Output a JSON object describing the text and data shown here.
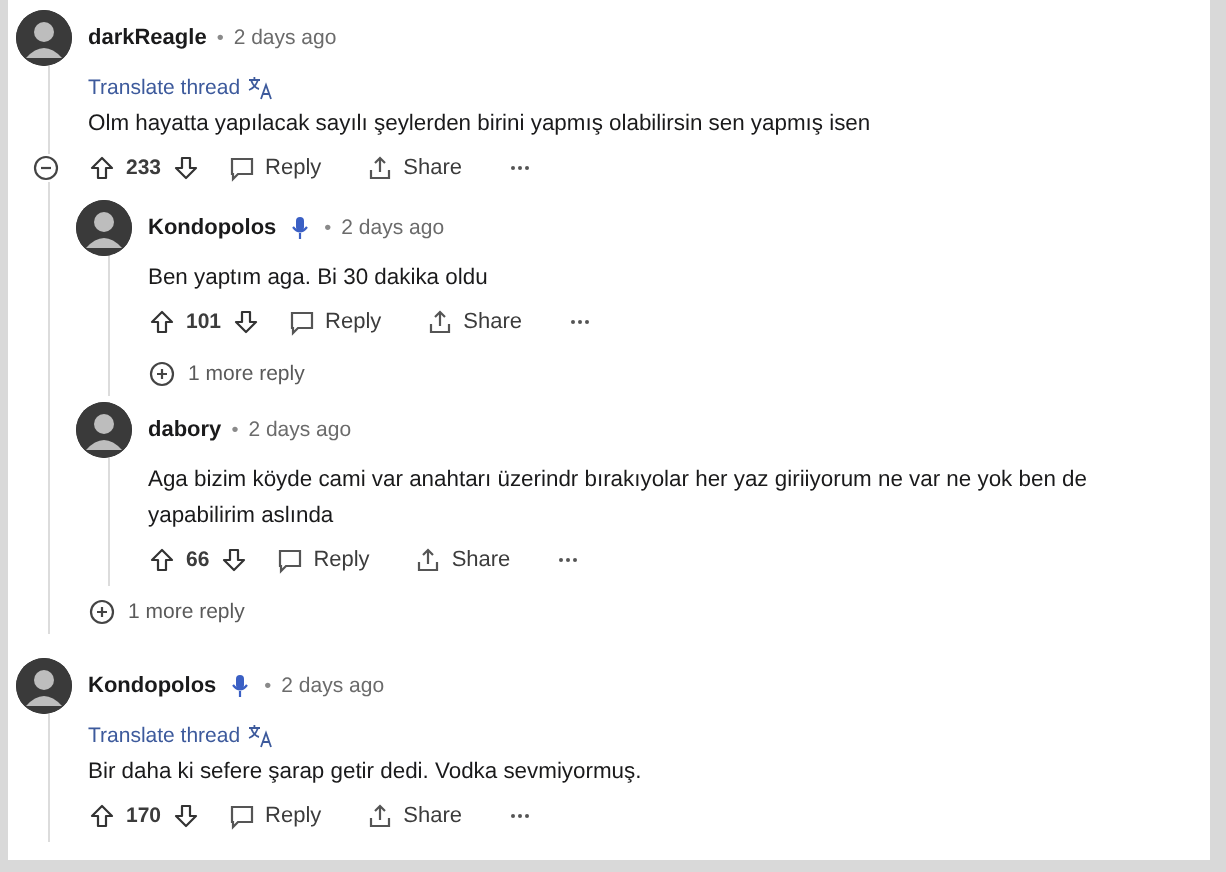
{
  "comments": [
    {
      "author": "darkReagle",
      "mic_badge": false,
      "separator": "•",
      "time": "2 days ago",
      "translate": "Translate thread",
      "text": "Olm hayatta yapılacak sayılı şeylerden birini yapmış olabilirsin sen yapmış isen",
      "votes": "233",
      "reply": "Reply",
      "share": "Share",
      "collapsible": true,
      "more_replies": "1 more reply",
      "replies": [
        {
          "author": "Kondopolos",
          "mic_badge": true,
          "separator": "•",
          "time": "2 days ago",
          "text": "Ben yaptım aga. Bi 30 dakika oldu",
          "votes": "101",
          "reply": "Reply",
          "share": "Share",
          "collapsible": false,
          "more_replies": "1 more reply"
        },
        {
          "author": "dabory",
          "mic_badge": false,
          "separator": "•",
          "time": "2 days ago",
          "text": "Aga bizim köyde cami var anahtarı üzerindr bırakıyolar her yaz giriiyorum ne var ne yok ben de yapabilirim aslında",
          "votes": "66",
          "reply": "Reply",
          "share": "Share",
          "collapsible": false
        }
      ]
    },
    {
      "author": "Kondopolos",
      "mic_badge": true,
      "separator": "•",
      "time": "2 days ago",
      "translate": "Translate thread",
      "text": "Bir daha ki sefere şarap getir dedi. Vodka sevmiyormuş.",
      "votes": "170",
      "reply": "Reply",
      "share": "Share",
      "collapsible": false
    }
  ]
}
